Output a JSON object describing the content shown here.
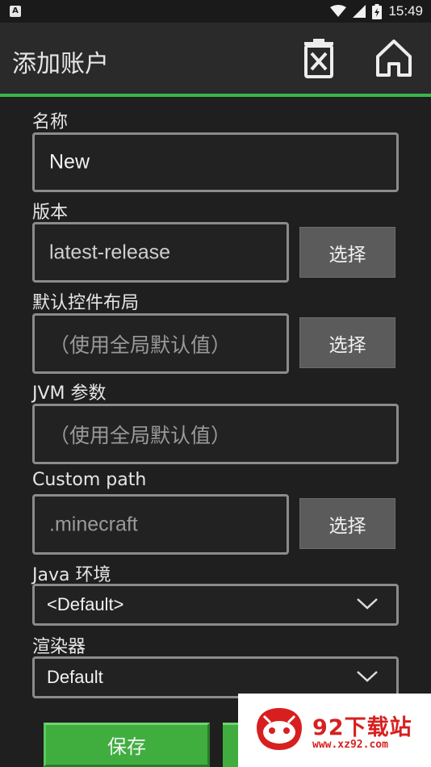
{
  "status_bar": {
    "notification_glyph": "A",
    "time": "15:49",
    "icons": [
      "wifi-icon",
      "signal-icon",
      "battery-icon"
    ]
  },
  "app_bar": {
    "title": "添加账户",
    "actions": [
      "delete-icon",
      "home-icon"
    ],
    "accent": "#39b54a"
  },
  "form": {
    "name": {
      "label": "名称",
      "value": "New"
    },
    "version": {
      "label": "版本",
      "value": "latest-release",
      "button": "选择"
    },
    "control_layout": {
      "label": "默认控件布局",
      "placeholder": "（使用全局默认值）",
      "button": "选择"
    },
    "jvm_args": {
      "label": "JVM 参数",
      "placeholder": "（使用全局默认值）"
    },
    "custom_path": {
      "label": "Custom path",
      "placeholder": ".minecraft",
      "button": "选择"
    },
    "java_env": {
      "label": "Java 环境",
      "selected": "<Default>"
    },
    "renderer": {
      "label": "渲染器",
      "selected": "Default"
    },
    "save_label": "保存"
  },
  "watermark": {
    "title": "92下载站",
    "url": "www.xz92.com"
  }
}
